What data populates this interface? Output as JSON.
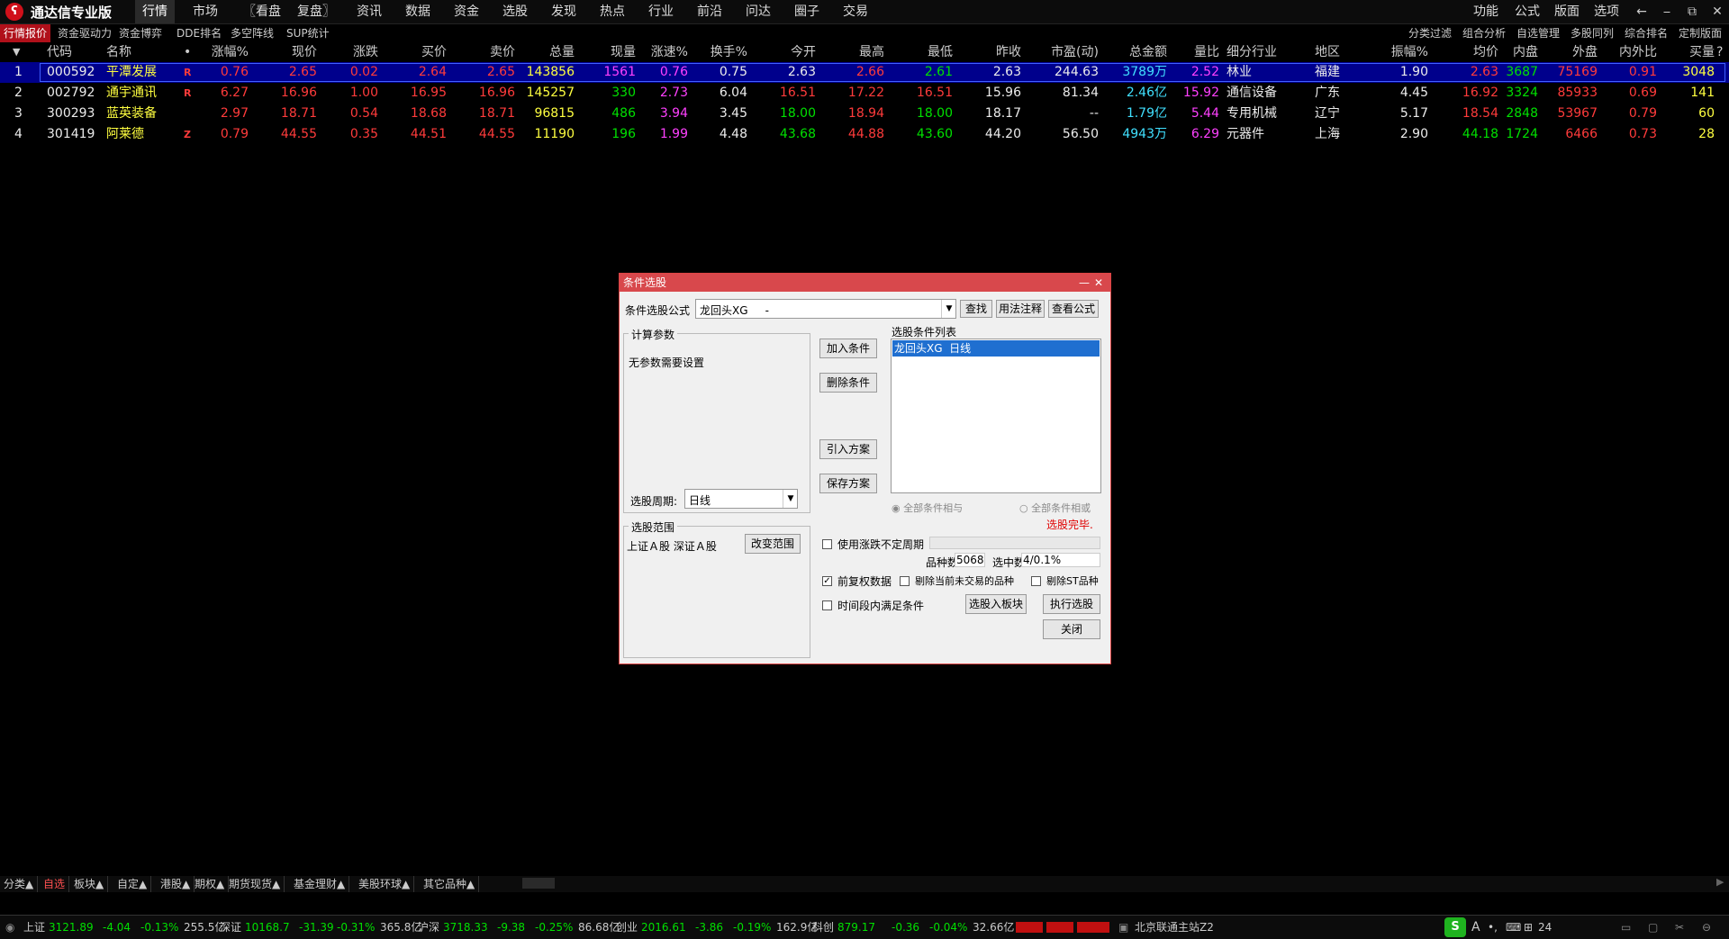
{
  "app": {
    "title": "通达信专业版",
    "logo_glyph": "ꗾ"
  },
  "menu": [
    "行情",
    "市场",
    "〖看盘",
    "复盘〗",
    "资讯",
    "数据",
    "资金",
    "选股",
    "发现",
    "热点",
    "行业",
    "前沿",
    "问达",
    "圈子",
    "交易"
  ],
  "right_menu": [
    "功能",
    "公式",
    "版面",
    "选项"
  ],
  "window_buttons": [
    "←",
    "⎯",
    "⧉",
    "✕"
  ],
  "subtabs_left": [
    "行情报价",
    "资金驱动力",
    "资金博弈",
    "DDE排名",
    "多空阵线",
    "SUP统计"
  ],
  "subtabs_right": [
    "分类过滤",
    "组合分析",
    "自选管理",
    "多股同列",
    "综合排名",
    "定制版面"
  ],
  "table": {
    "headers": [
      "代码",
      "名称",
      "•",
      "涨幅%",
      "现价",
      "涨跌",
      "买价",
      "卖价",
      "总量",
      "现量",
      "涨速%",
      "换手%",
      "今开",
      "最高",
      "最低",
      "昨收",
      "市盈(动)",
      "总金额",
      "量比",
      "细分行业",
      "地区",
      "振幅%",
      "均价",
      "内盘",
      "外盘",
      "内外比",
      "买量"
    ],
    "rows": [
      {
        "idx": "1",
        "code": "000592",
        "name": "平潭发展",
        "flag": "R",
        "chg_pct": "0.76",
        "price": "2.65",
        "chg": "0.02",
        "bid": "2.64",
        "ask": "2.65",
        "vol": "143856",
        "cur_vol": "1561",
        "speed": "0.76",
        "turnover": "0.75",
        "open": "2.63",
        "high": "2.66",
        "low": "2.61",
        "prev": "2.63",
        "pe": "244.63",
        "amount": "3789万",
        "vol_ratio": "2.52",
        "industry": "林业",
        "region": "福建",
        "amplitude": "1.90",
        "avg": "2.63",
        "inner": "3687",
        "outer": "75169",
        "io_ratio": "0.91",
        "bid_vol": "3048"
      },
      {
        "idx": "2",
        "code": "002792",
        "name": "通宇通讯",
        "flag": "R",
        "chg_pct": "6.27",
        "price": "16.96",
        "chg": "1.00",
        "bid": "16.95",
        "ask": "16.96",
        "vol": "145257",
        "cur_vol": "330",
        "speed": "2.73",
        "turnover": "6.04",
        "open": "16.51",
        "high": "17.22",
        "low": "16.51",
        "prev": "15.96",
        "pe": "81.34",
        "amount": "2.46亿",
        "vol_ratio": "15.92",
        "industry": "通信设备",
        "region": "广东",
        "amplitude": "4.45",
        "avg": "16.92",
        "inner": "3324",
        "outer": "85933",
        "io_ratio": "0.69",
        "bid_vol": "141"
      },
      {
        "idx": "3",
        "code": "300293",
        "name": "蓝英装备",
        "flag": "",
        "chg_pct": "2.97",
        "price": "18.71",
        "chg": "0.54",
        "bid": "18.68",
        "ask": "18.71",
        "vol": "96815",
        "cur_vol": "486",
        "speed": "3.94",
        "turnover": "3.45",
        "open": "18.00",
        "high": "18.94",
        "low": "18.00",
        "prev": "18.17",
        "pe": "--",
        "amount": "1.79亿",
        "vol_ratio": "5.44",
        "industry": "专用机械",
        "region": "辽宁",
        "amplitude": "5.17",
        "avg": "18.54",
        "inner": "2848",
        "outer": "53967",
        "io_ratio": "0.79",
        "bid_vol": "60"
      },
      {
        "idx": "4",
        "code": "301419",
        "name": "阿莱德",
        "flag": "Z",
        "chg_pct": "0.79",
        "price": "44.55",
        "chg": "0.35",
        "bid": "44.51",
        "ask": "44.55",
        "vol": "11190",
        "cur_vol": "196",
        "speed": "1.99",
        "turnover": "4.48",
        "open": "43.68",
        "high": "44.88",
        "low": "43.60",
        "prev": "44.20",
        "pe": "56.50",
        "amount": "4943万",
        "vol_ratio": "6.29",
        "industry": "元器件",
        "region": "上海",
        "amplitude": "2.90",
        "avg": "44.18",
        "inner": "1724",
        "outer": "6466",
        "io_ratio": "0.73",
        "bid_vol": "28"
      }
    ]
  },
  "dialog": {
    "title": "条件选股",
    "formula_label": "条件选股公式",
    "formula_value": "龙回头XG     -",
    "btn_find": "查找",
    "btn_usage": "用法注释",
    "btn_view": "查看公式",
    "params_group": "计算参数",
    "no_params": "无参数需要设置",
    "period_label": "选股周期:",
    "period_value": "日线",
    "btn_add": "加入条件",
    "btn_del": "删除条件",
    "btn_import": "引入方案",
    "btn_save": "保存方案",
    "cond_list_label": "选股条件列表",
    "cond_item": "龙回头XG  日线",
    "radio_and": "全部条件相与",
    "radio_or": "全部条件相或",
    "done_text": "选股完毕.",
    "range_group": "选股范围",
    "range_value": "上证Ａ股 深证Ａ股",
    "btn_range": "改变范围",
    "chk_uncertain": "使用涨跌不定周期",
    "count_label": "品种数",
    "count_value": "5068",
    "selected_label": "选中数",
    "selected_value": "4/0.1%",
    "chk_forward": "前复权数据",
    "chk_remove_suspended": "剔除当前未交易的品种",
    "chk_remove_st": "剔除ST品种",
    "chk_time": "时间段内满足条件",
    "btn_to_block": "选股入板块",
    "btn_execute": "执行选股",
    "btn_close": "关闭"
  },
  "bottom_tabs": [
    "分类▲",
    "自选",
    "板块▲",
    "自定▲",
    "港股▲",
    "期权▲",
    "期货现货▲",
    "基金理财▲",
    "美股环球▲",
    "其它品种▲"
  ],
  "status": {
    "sh": {
      "name": "上证",
      "val": "3121.89",
      "chg": "-4.04",
      "pct": "-0.13%",
      "amt": "255.5亿"
    },
    "sz": {
      "name": "深证",
      "val": "10168.7",
      "chg": "-31.39",
      "pct": "-0.31%",
      "amt": "365.8亿"
    },
    "hs": {
      "name": "沪深",
      "val": "3718.33",
      "chg": "-9.38",
      "pct": "-0.25%",
      "amt": "86.68亿"
    },
    "cy": {
      "name": "创业",
      "val": "2016.61",
      "chg": "-3.86",
      "pct": "-0.19%",
      "amt": "162.9亿"
    },
    "kc": {
      "name": "科创",
      "val": "879.17",
      "chg": "-0.36",
      "pct": "-0.04%",
      "amt": "32.66亿"
    },
    "server": "北京联通主站Z2",
    "clock": "24"
  }
}
